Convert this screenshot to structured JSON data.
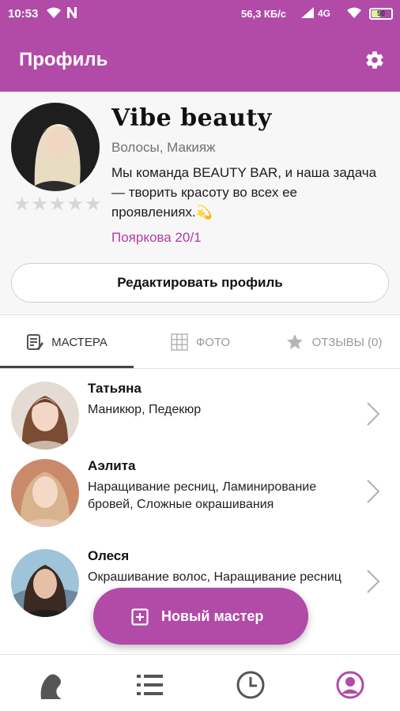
{
  "status_bar": {
    "time": "10:53",
    "speed": "56,3 КБ/с",
    "network": "4G",
    "battery": "50",
    "battery_percent": 50
  },
  "app_bar": {
    "title": "Профиль",
    "settings_icon": "gear-icon"
  },
  "profile": {
    "name": "Vibe beauty",
    "categories": "Волосы, Макияж",
    "description": "Мы команда BEAUTY BAR, и наша задача — творить красоту во всех ее проявлениях.💫",
    "address": "Пояркова 20/1",
    "rating": 0,
    "rating_max": 5,
    "edit_button": "Редактировать профиль"
  },
  "tabs": [
    {
      "label": "МАСТЕРА",
      "icon": "masters-list-icon",
      "active": true
    },
    {
      "label": "ФОТО",
      "icon": "photo-grid-icon",
      "active": false
    },
    {
      "label": "ОТЗЫВЫ (0)",
      "icon": "star-icon",
      "active": false
    }
  ],
  "masters": [
    {
      "name": "Татьяна",
      "services": "Маникюр, Педекюр"
    },
    {
      "name": "Аэлита",
      "services": "Наращивание ресниц, Ламинирование бровей, Сложные окрашивания"
    },
    {
      "name": "Олеся",
      "services": "Окрашивание волос, Наращивание ресниц"
    }
  ],
  "fab": {
    "label": "Новый мастер",
    "icon": "add-box-icon"
  },
  "bottom_nav": [
    {
      "icon": "salon-silhouette-icon",
      "active": false
    },
    {
      "icon": "list-icon",
      "active": false
    },
    {
      "icon": "clock-icon",
      "active": false
    },
    {
      "icon": "profile-icon",
      "active": true
    }
  ],
  "colors": {
    "brand": "#b24aa8",
    "accent_text": "#b03ca6",
    "inactive_icon": "#555555"
  }
}
